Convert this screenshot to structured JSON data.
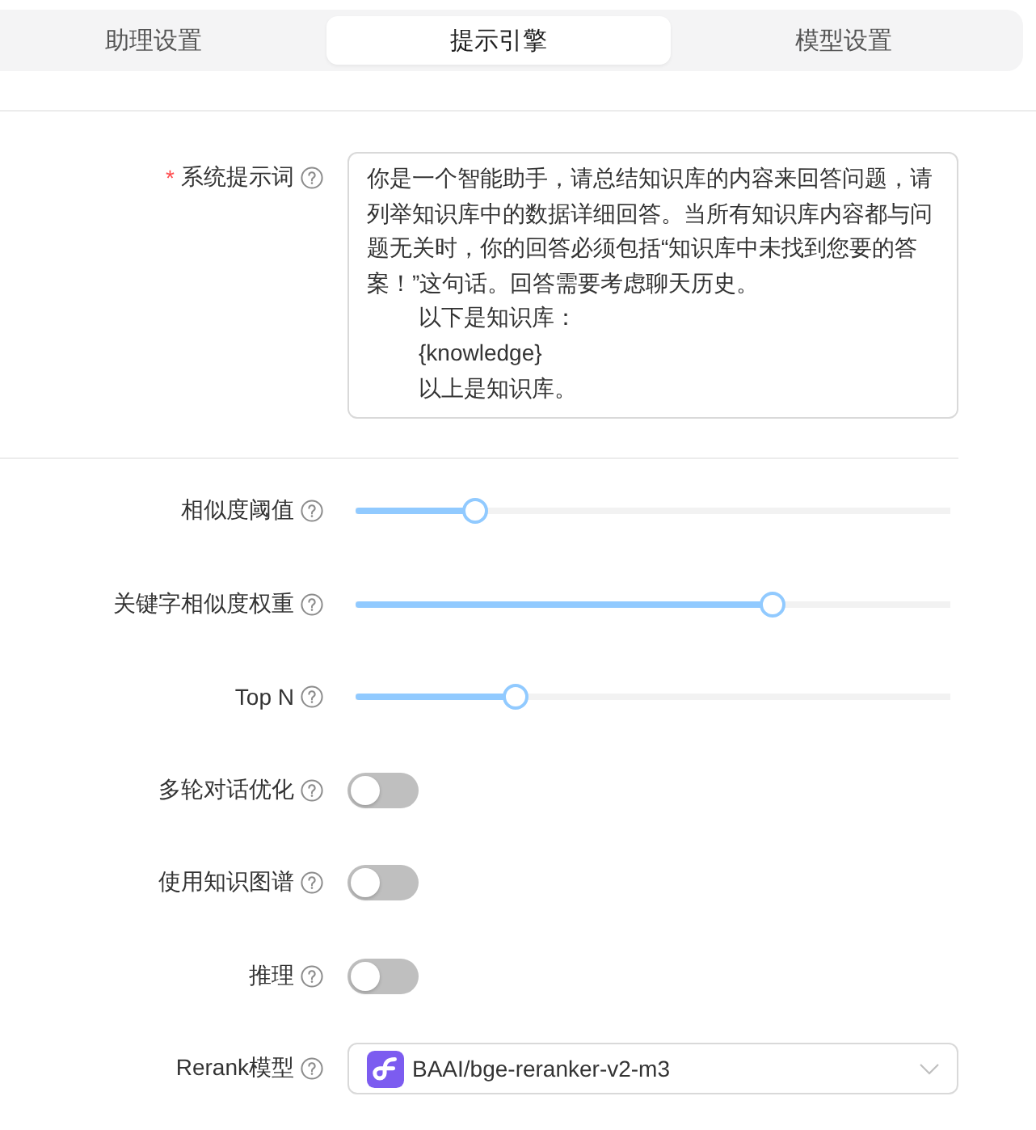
{
  "tabs": [
    {
      "label": "助理设置",
      "selected": false
    },
    {
      "label": "提示引擎",
      "selected": true
    },
    {
      "label": "模型设置",
      "selected": false
    }
  ],
  "system_prompt": {
    "required_mark": "*",
    "label": "系统提示词",
    "lines": [
      {
        "text": "你是一个智能助手，请总结知识库的内容来回答问题，请列举知识库中的数据详细回答。当所有知识库内容都与问题无关时，你的回答必须包括“知识库中未找到您要的答案！”这句话。回答需要考虑聊天历史。",
        "indented": false
      },
      {
        "text": "以下是知识库：",
        "indented": true
      },
      {
        "text": "{knowledge}",
        "indented": true
      },
      {
        "text": "以上是知识库。",
        "indented": true
      }
    ]
  },
  "sliders": [
    {
      "label": "相似度阈值",
      "level": 0.2
    },
    {
      "label": "关键字相似度权重",
      "level": 0.7
    },
    {
      "label": "Top N",
      "level": 0.27
    }
  ],
  "switches": [
    {
      "label": "多轮对话优化",
      "on": false
    },
    {
      "label": "使用知识图谱",
      "on": false
    },
    {
      "label": "推理",
      "on": false
    }
  ],
  "rerank_model": {
    "label": "Rerank模型",
    "value": "BAAI/bge-reranker-v2-m3"
  }
}
